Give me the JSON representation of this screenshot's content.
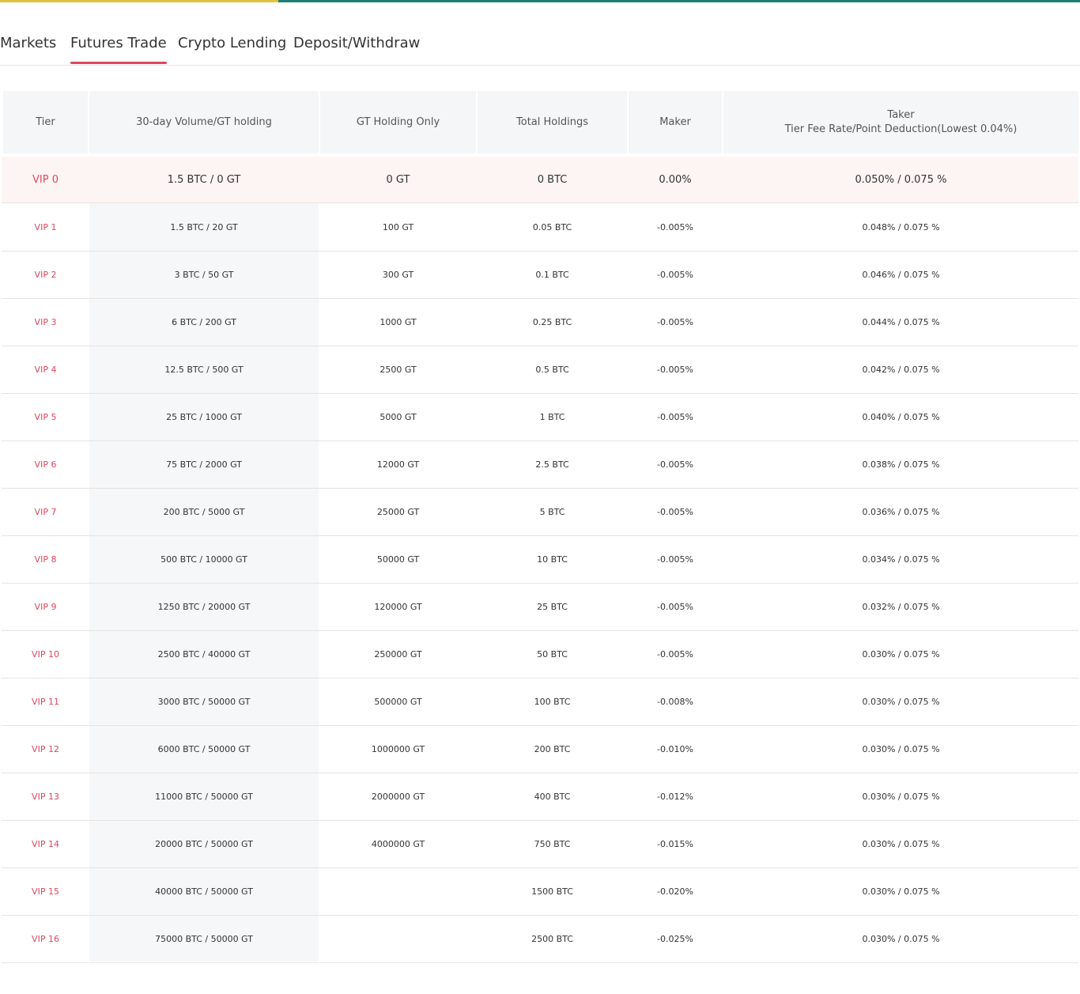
{
  "colors": {
    "accent": "#e0465e",
    "top_bar_left": "#e1c13f",
    "top_bar_right": "#1e7f74",
    "highlight_row_bg": "#fdf5f4"
  },
  "tabs": [
    {
      "label": "Markets",
      "active": false
    },
    {
      "label": "Futures Trade",
      "active": true
    },
    {
      "label": "Crypto Lending",
      "active": false
    },
    {
      "label": "Deposit/Withdraw",
      "active": false
    }
  ],
  "table": {
    "headers": {
      "tier": "Tier",
      "volume": "30-day Volume/GT holding",
      "gt_only": "GT Holding Only",
      "total": "Total Holdings",
      "maker": "Maker",
      "taker_line1": "Taker",
      "taker_line2": "Tier Fee Rate/Point Deduction(Lowest 0.04%)"
    },
    "rows": [
      [
        "VIP 0",
        "1.5 BTC / 0 GT",
        "0 GT",
        "0 BTC",
        "0.00%",
        "0.050% / 0.075 %"
      ],
      [
        "VIP 1",
        "1.5 BTC / 20 GT",
        "100 GT",
        "0.05 BTC",
        "-0.005%",
        "0.048% / 0.075 %"
      ],
      [
        "VIP 2",
        "3 BTC / 50 GT",
        "300 GT",
        "0.1 BTC",
        "-0.005%",
        "0.046% / 0.075 %"
      ],
      [
        "VIP 3",
        "6 BTC / 200 GT",
        "1000 GT",
        "0.25 BTC",
        "-0.005%",
        "0.044% / 0.075 %"
      ],
      [
        "VIP 4",
        "12.5 BTC / 500 GT",
        "2500 GT",
        "0.5 BTC",
        "-0.005%",
        "0.042% / 0.075 %"
      ],
      [
        "VIP 5",
        "25 BTC / 1000 GT",
        "5000 GT",
        "1 BTC",
        "-0.005%",
        "0.040% / 0.075 %"
      ],
      [
        "VIP 6",
        "75 BTC / 2000 GT",
        "12000 GT",
        "2.5 BTC",
        "-0.005%",
        "0.038% / 0.075 %"
      ],
      [
        "VIP 7",
        "200 BTC / 5000 GT",
        "25000 GT",
        "5 BTC",
        "-0.005%",
        "0.036% / 0.075 %"
      ],
      [
        "VIP 8",
        "500 BTC / 10000 GT",
        "50000 GT",
        "10 BTC",
        "-0.005%",
        "0.034% / 0.075 %"
      ],
      [
        "VIP 9",
        "1250 BTC / 20000 GT",
        "120000 GT",
        "25 BTC",
        "-0.005%",
        "0.032% / 0.075 %"
      ],
      [
        "VIP 10",
        "2500 BTC / 40000 GT",
        "250000 GT",
        "50 BTC",
        "-0.005%",
        "0.030% / 0.075 %"
      ],
      [
        "VIP 11",
        "3000 BTC / 50000 GT",
        "500000 GT",
        "100 BTC",
        "-0.008%",
        "0.030% / 0.075 %"
      ],
      [
        "VIP 12",
        "6000 BTC / 50000 GT",
        "1000000 GT",
        "200 BTC",
        "-0.010%",
        "0.030% / 0.075 %"
      ],
      [
        "VIP 13",
        "11000 BTC / 50000 GT",
        "2000000 GT",
        "400 BTC",
        "-0.012%",
        "0.030% / 0.075 %"
      ],
      [
        "VIP 14",
        "20000 BTC / 50000 GT",
        "4000000 GT",
        "750 BTC",
        "-0.015%",
        "0.030% / 0.075 %"
      ],
      [
        "VIP 15",
        "40000 BTC / 50000 GT",
        "",
        "1500 BTC",
        "-0.020%",
        "0.030% / 0.075 %"
      ],
      [
        "VIP 16",
        "75000 BTC / 50000 GT",
        "",
        "2500 BTC",
        "-0.025%",
        "0.030% / 0.075 %"
      ]
    ]
  }
}
